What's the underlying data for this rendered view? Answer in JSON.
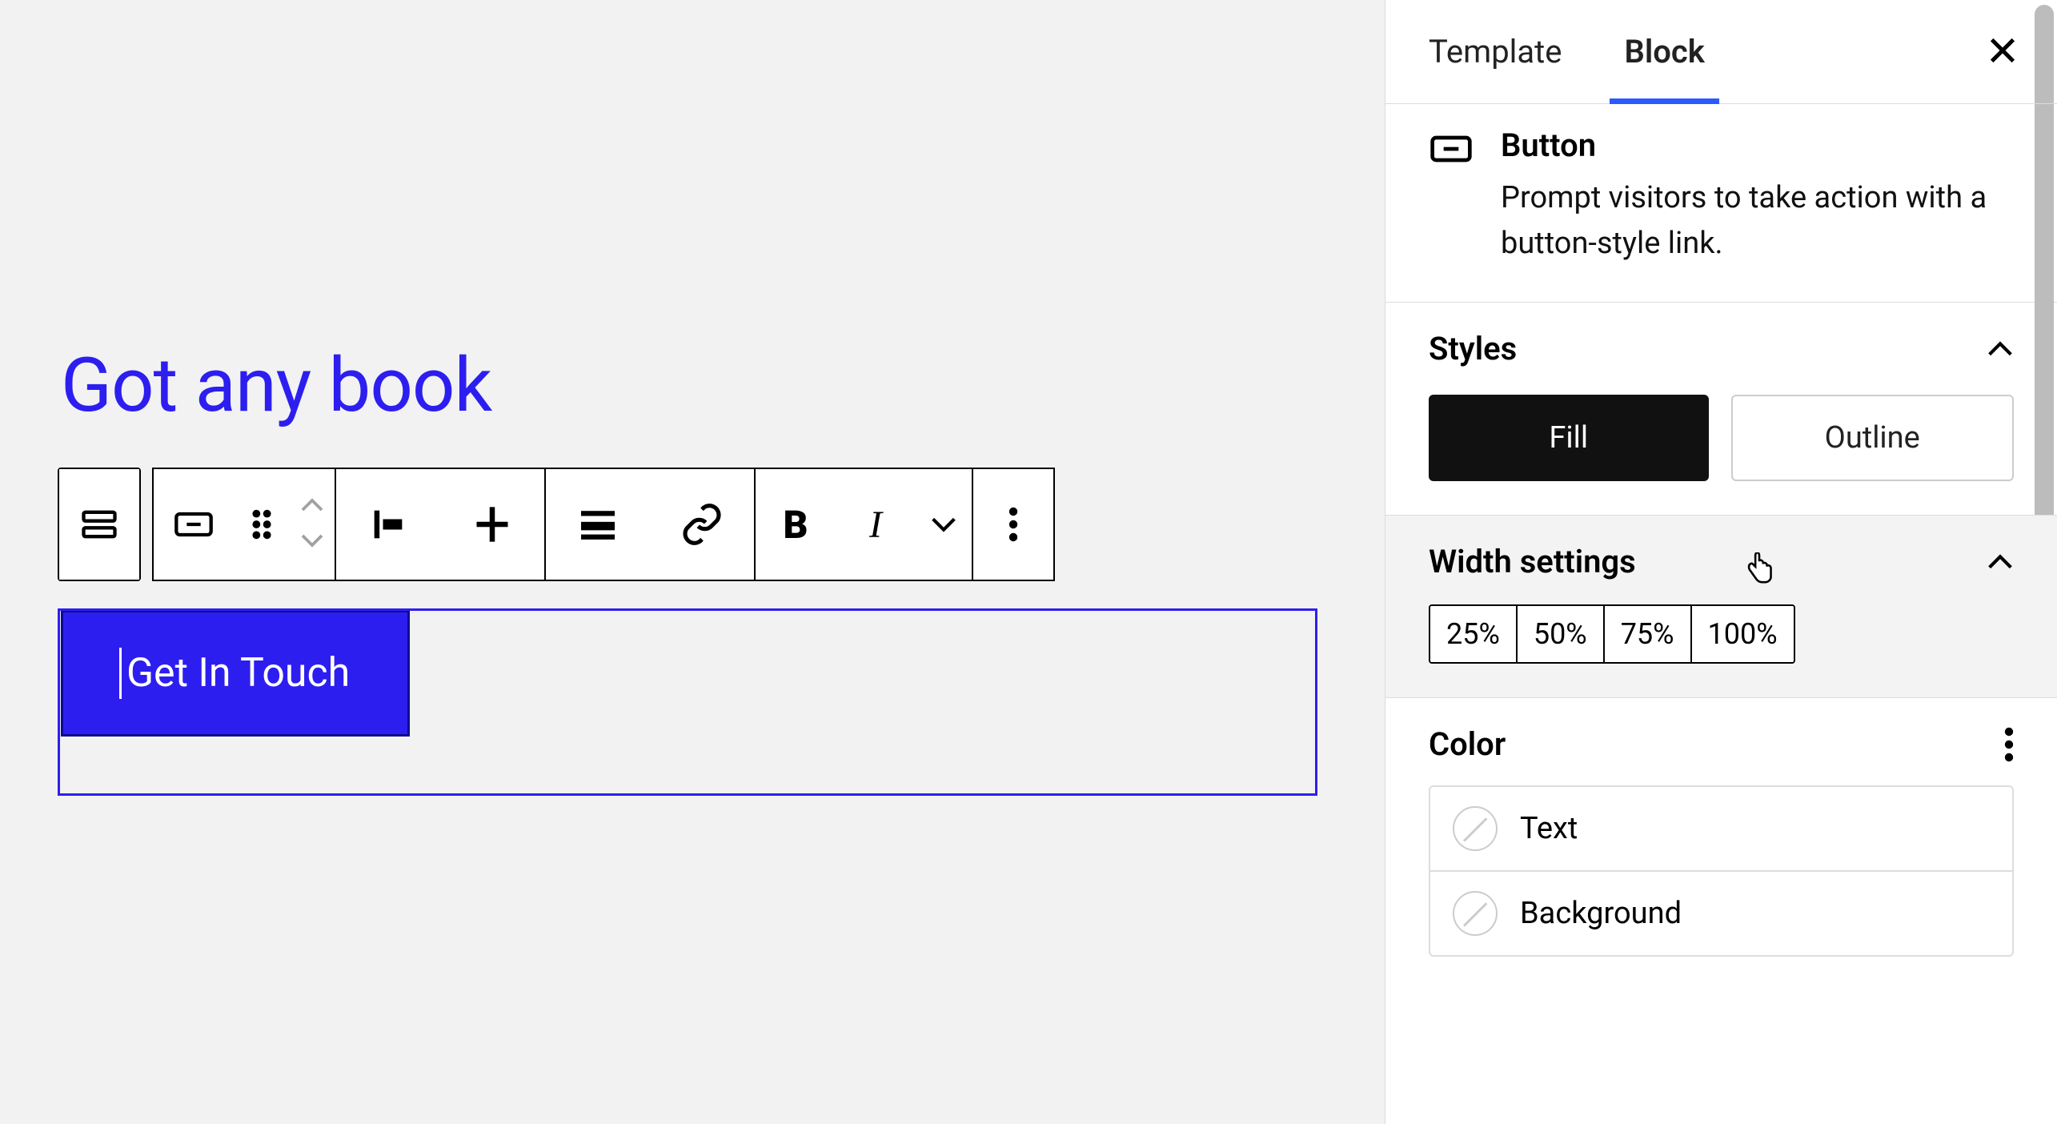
{
  "editor": {
    "heading_text": "Got any book",
    "button_label": "Get In Touch"
  },
  "toolbar": {
    "icons": {
      "parent": "buttons-parent-icon",
      "block_type": "button-block-icon",
      "drag": "drag-handle-icon",
      "move_up": "chevron-up-icon",
      "move_down": "chevron-down-icon",
      "justify": "justify-left-icon",
      "align_vert": "align-center-vertical-icon",
      "align": "align-full-icon",
      "link": "link-icon",
      "bold": "bold-icon",
      "italic": "italic-icon",
      "more_rich": "chevron-down-icon",
      "options": "more-vertical-icon"
    }
  },
  "inspector": {
    "tabs": {
      "template": "Template",
      "block": "Block"
    },
    "block_card": {
      "title": "Button",
      "description": "Prompt visitors to take action with a button-style link."
    },
    "styles": {
      "heading": "Styles",
      "fill": "Fill",
      "outline": "Outline"
    },
    "width": {
      "heading": "Width settings",
      "options": [
        "25%",
        "50%",
        "75%",
        "100%"
      ]
    },
    "color": {
      "heading": "Color",
      "rows": {
        "text": "Text",
        "background": "Background"
      }
    }
  }
}
